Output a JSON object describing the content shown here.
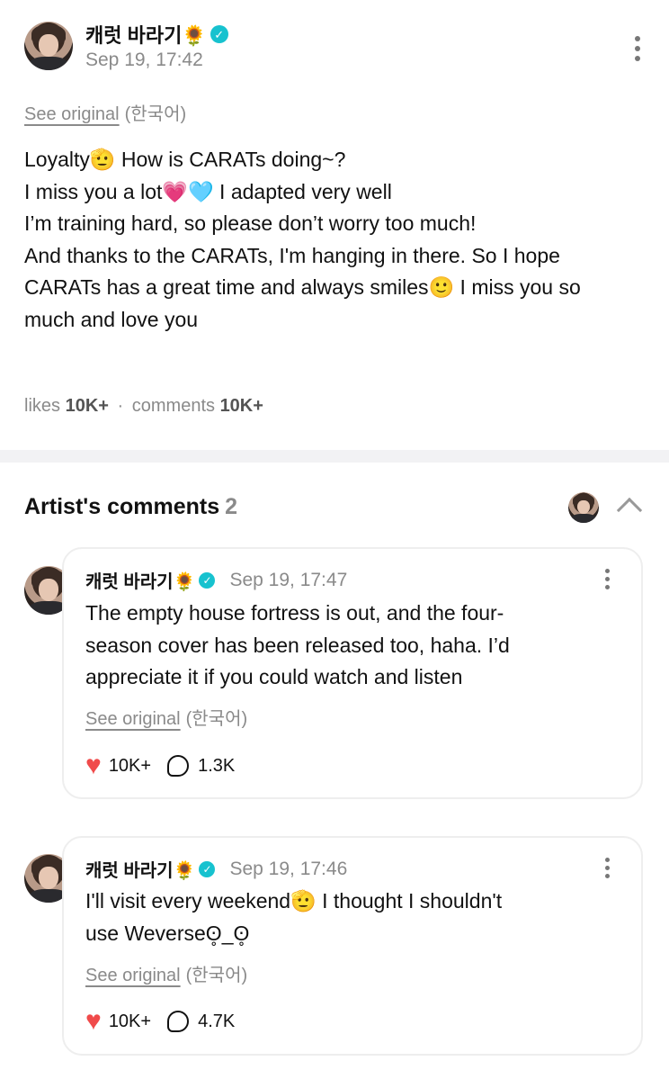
{
  "post": {
    "author": "캐럿 바라기🌻",
    "verified_icon": "verified-check-icon",
    "time": "Sep 19, 17:42",
    "see_original": "See original",
    "language": "(한국어)",
    "body_lines": [
      "Loyalty🫡 How is CARATs doing~?",
      "I miss you a lot💗🩵 I adapted very well",
      "I’m training hard, so please don’t worry too much!",
      "And thanks to the CARATs, I'm hanging in there. So I hope",
      "CARATs has a great time and always smiles🙂 I miss you so",
      "much and love you"
    ],
    "likes_label": "likes",
    "likes": "10K+",
    "separator": "·",
    "comments_label": "comments",
    "comments": "10K+"
  },
  "artist_comments": {
    "title": "Artist's comments",
    "count": "2",
    "items": [
      {
        "author": "캐럿 바라기🌻",
        "time": "Sep 19, 17:47",
        "text_lines": [
          "The empty house fortress is out, and the four-",
          "season cover has been released too, haha. I’d",
          "appreciate it if you could watch and listen"
        ],
        "see_original": "See original",
        "language": "(한국어)",
        "likes": "10K+",
        "replies": "1.3K"
      },
      {
        "author": "캐럿 바라기🌻",
        "time": "Sep 19, 17:46",
        "text_lines": [
          "I'll visit every weekend🫡 I thought I shouldn't",
          "use Weverseʘ̥_ʘ̥"
        ],
        "see_original": "See original",
        "language": "(한국어)",
        "likes": "10K+",
        "replies": "4.7K"
      }
    ]
  },
  "colors": {
    "verified": "#17c2cf",
    "heart": "#f04a4a",
    "muted": "#8a8a8a"
  }
}
